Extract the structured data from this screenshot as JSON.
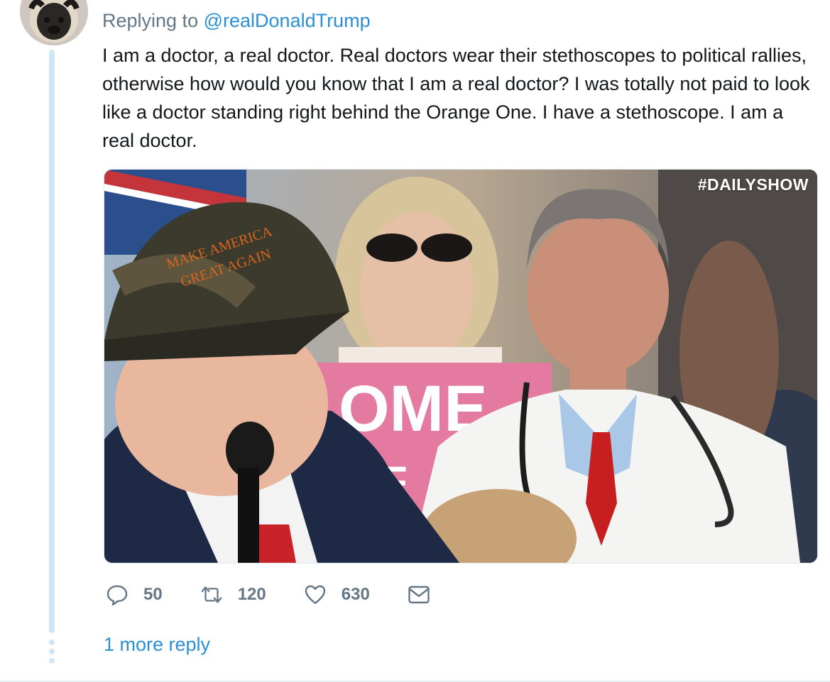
{
  "reply_header": {
    "prefix": "Replying to",
    "handle": "@realDonaldTrump"
  },
  "tweet": {
    "text": "I am a doctor, a real doctor. Real doctors wear their stethoscopes to political rallies, otherwise how would you know that I am a real doctor? I was totally not paid to look like a doctor standing right behind the Orange One. I have a stethoscope. I am a real doctor."
  },
  "media": {
    "watermark": "#DAILYSHOW",
    "hat_text_line1": "MAKE AMERICA",
    "hat_text_line2": "GREAT AGAIN",
    "sign_text": "OME",
    "sign_text_2": "F"
  },
  "actions": {
    "reply_count": "50",
    "retweet_count": "120",
    "like_count": "630"
  },
  "more_replies": "1 more reply",
  "colors": {
    "accent": "#2b8fd6",
    "thread_line": "#cde7f9",
    "muted": "#657786"
  },
  "icons": [
    "pug-avatar",
    "reply-icon",
    "retweet-icon",
    "like-icon",
    "direct-message-icon"
  ]
}
